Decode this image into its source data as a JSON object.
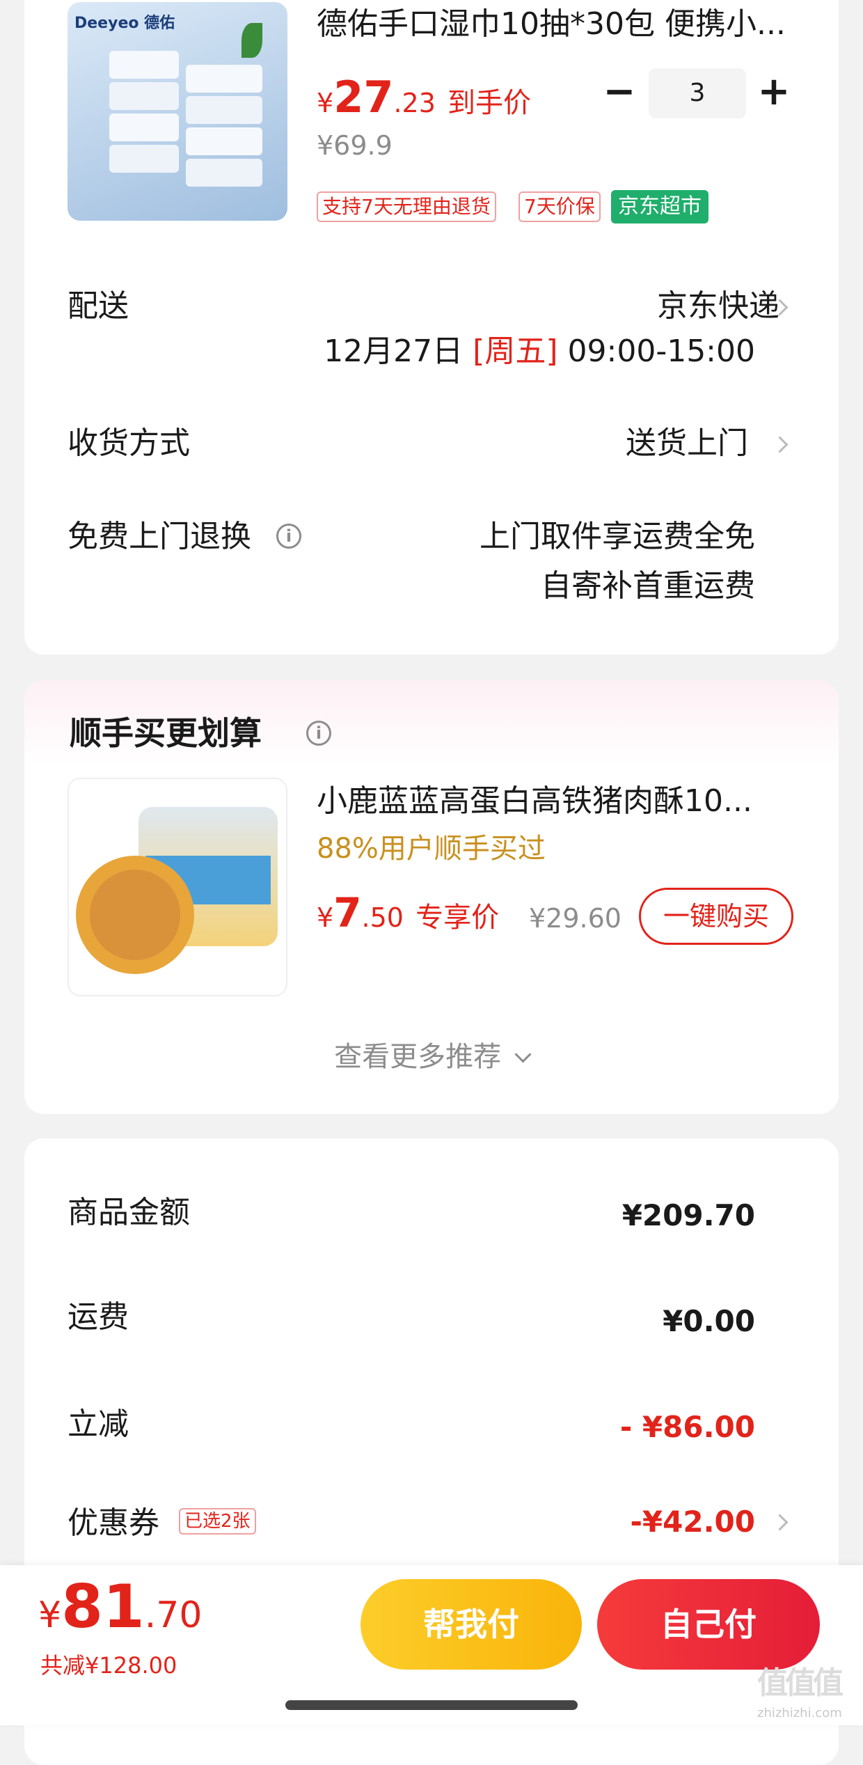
{
  "product": {
    "image_brand": "Deeyeo 德佑",
    "title": "德佑手口湿巾10抽*30包 便携小...",
    "price_symbol": "¥",
    "price_int": "27",
    "price_dec": ".23",
    "price_tag": "到手价",
    "original_price": "¥69.9",
    "quantity": "3",
    "minus_label": "−",
    "plus_label": "+",
    "tags": [
      "支持7天无理由退货",
      "7天价保"
    ],
    "store_badge": "京东超市"
  },
  "delivery": {
    "label": "配送",
    "carrier": "京东快递",
    "date": "12月27日",
    "weekday": "[周五]",
    "time": "09:00-15:00"
  },
  "receive": {
    "label": "收货方式",
    "value": "送货上门"
  },
  "returns": {
    "label": "免费上门退换",
    "line1": "上门取件享运费全免",
    "line2": "自寄补首重运费"
  },
  "recommend": {
    "title": "顺手买更划算",
    "item_title": "小鹿蓝蓝高蛋白高铁猪肉酥10...",
    "item_sub": "88%用户顺手买过",
    "price_symbol": "¥",
    "price_int": "7",
    "price_dec": ".50",
    "price_tag": "专享价",
    "original_price": "¥29.60",
    "buy_button": "一键购买",
    "more": "查看更多推荐"
  },
  "summary": {
    "goods_label": "商品金额",
    "goods_value": "¥209.70",
    "shipping_label": "运费",
    "shipping_value": "¥0.00",
    "discount_label": "立减",
    "discount_value": "- ¥86.00",
    "coupon_label": "优惠券",
    "coupon_badge": "已选2张",
    "coupon_value": "-¥42.00"
  },
  "footer": {
    "price_symbol": "¥",
    "price_int": "81",
    "price_dec": ".70",
    "total_saving": "共减¥128.00",
    "help_pay": "帮我付",
    "self_pay": "自己付"
  },
  "watermark": {
    "logo": "值",
    "url": "zhizhizhi.com"
  },
  "colors": {
    "accent": "#e2231a",
    "green_badge": "#1fae6b",
    "yellow": "#fcc012"
  }
}
